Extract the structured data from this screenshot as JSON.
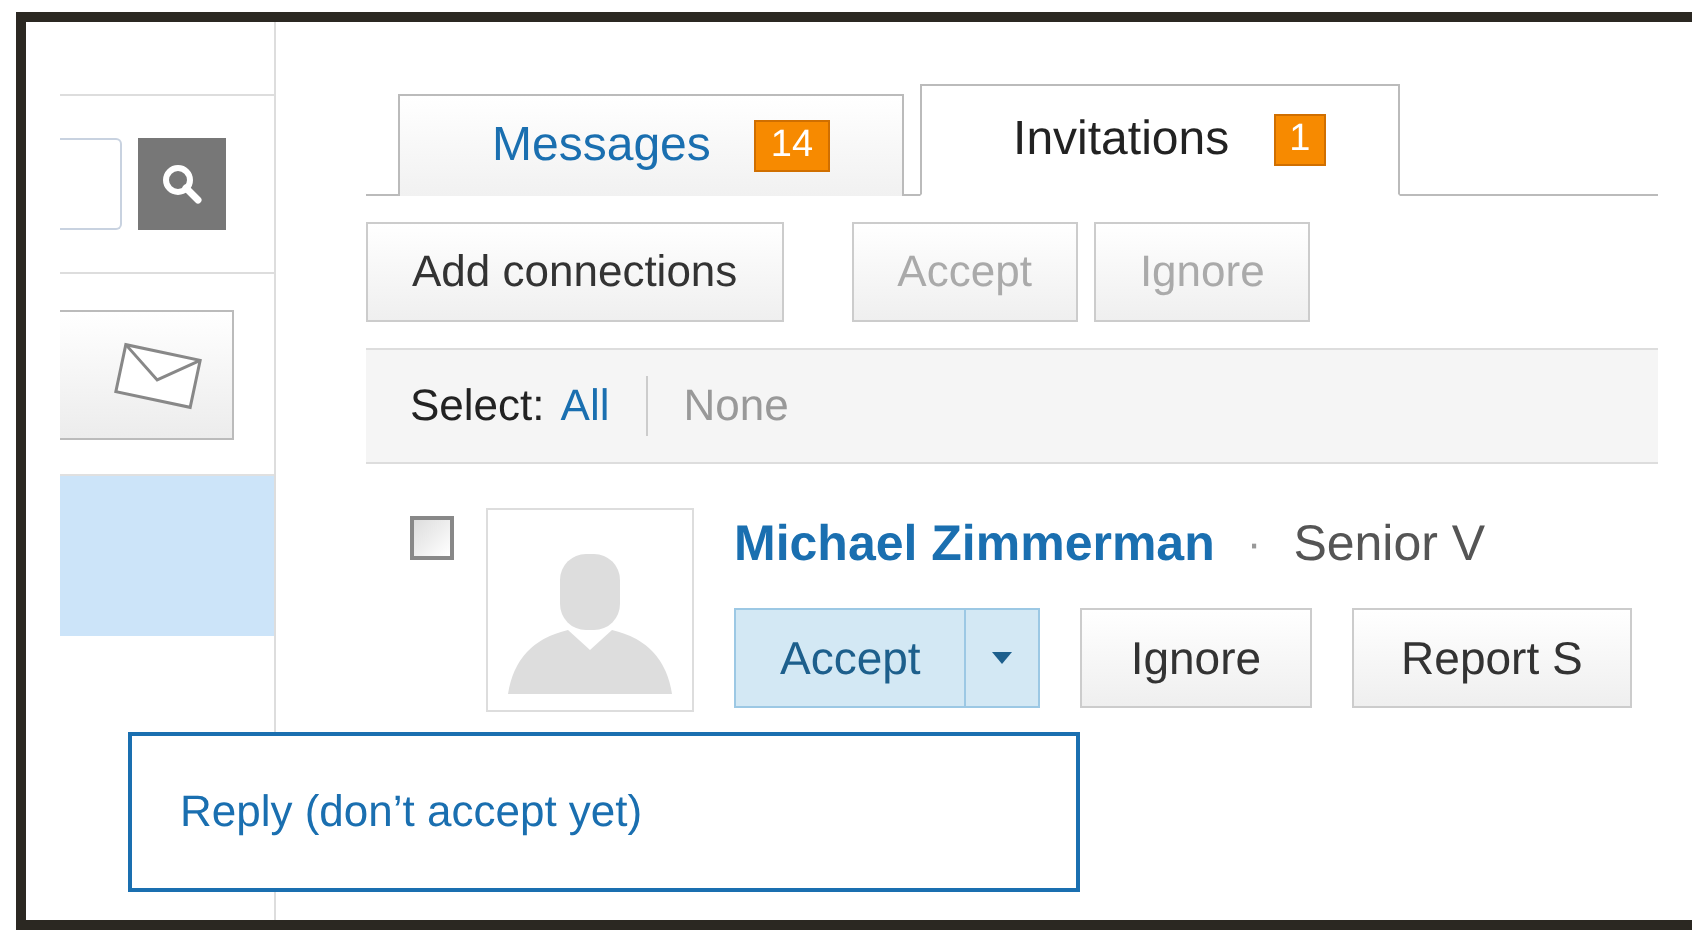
{
  "tabs": [
    {
      "label": "Messages",
      "count": "14",
      "selected": false
    },
    {
      "label": "Invitations",
      "count": "1",
      "selected": true
    }
  ],
  "toolbar": [
    {
      "label": "Add connections",
      "disabled": false
    },
    {
      "label": "Accept",
      "disabled": true
    },
    {
      "label": "Ignore",
      "disabled": true
    }
  ],
  "select": {
    "label": "Select:",
    "options": [
      {
        "label": "All",
        "disabled": false
      },
      {
        "label": "None",
        "disabled": true
      }
    ]
  },
  "invitation": {
    "checked": false,
    "name": "Michael Zimmerman",
    "separator": "·",
    "headline": "Senior V",
    "actions": [
      {
        "label": "Accept",
        "kind": "split"
      },
      {
        "label": "Ignore",
        "kind": "plain"
      },
      {
        "label": "Report S",
        "kind": "plain"
      }
    ]
  },
  "dropdown": {
    "items": [
      "Reply (don’t accept yet)"
    ]
  }
}
